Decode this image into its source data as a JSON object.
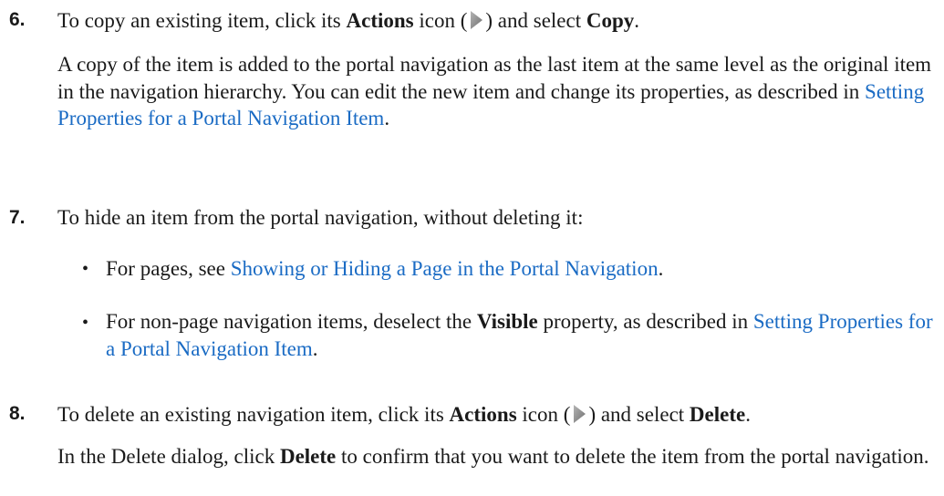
{
  "steps": [
    {
      "number": "6.",
      "text": {
        "a": "To copy an existing item, click its ",
        "b": "Actions",
        "c": " icon (",
        "d": ") and select ",
        "e": "Copy",
        "f": "."
      },
      "icon": "actions-triangle-icon",
      "paragraph": {
        "text": "A copy of the item is added to the portal navigation as the last item at the same level as the original item in the navigation hierarchy. You can edit the new item and change its properties, as described in ",
        "link": "Setting Properties for a Portal Navigation Item",
        "end": "."
      }
    },
    {
      "number": "7.",
      "text": "To hide an item from the portal navigation, without deleting it:",
      "bullets": [
        {
          "pre": "For pages, see ",
          "link": "Showing or Hiding a Page in the Portal Navigation",
          "post": "."
        },
        {
          "pre": "For non-page navigation items, deselect the ",
          "bold": "Visible",
          "mid": " property, as described in ",
          "link": "Setting Properties for a Portal Navigation Item",
          "post": "."
        }
      ]
    },
    {
      "number": "8.",
      "text": {
        "a": "To delete an existing navigation item, click its ",
        "b": "Actions",
        "c": " icon (",
        "d": ") and select ",
        "e": "Delete",
        "f": "."
      },
      "icon": "actions-triangle-icon",
      "paragraph": {
        "pre": "In the Delete dialog, click ",
        "bold": "Delete",
        "post": " to confirm that you want to delete the item from the portal navigation."
      }
    }
  ],
  "colors": {
    "link": "#1a6bc4",
    "text": "#1a1a1a",
    "icon": "#8c8c8c"
  }
}
